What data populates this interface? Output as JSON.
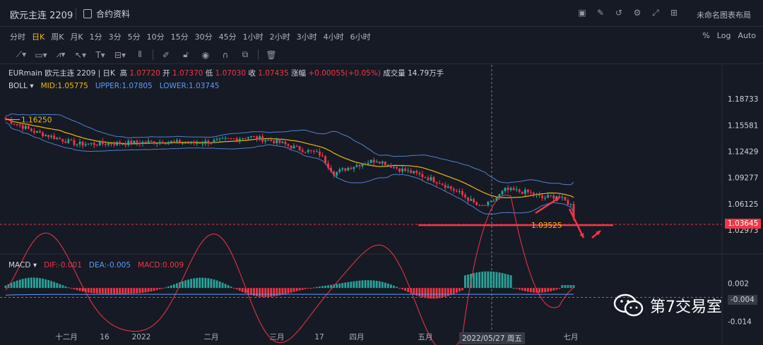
{
  "header": {
    "symbol_title": "欧元主连 2209",
    "contract_info": "合约资料",
    "layout_name": "未命名图表布局",
    "toolbar_icons": [
      "screenshot-icon",
      "edit-icon",
      "undo-icon",
      "settings-icon",
      "fullscreen-icon",
      "grid-layout-icon"
    ]
  },
  "intervals": {
    "items": [
      "分时",
      "日K",
      "周K",
      "月K",
      "1分",
      "3分",
      "5分",
      "10分",
      "15分",
      "30分",
      "45分",
      "1小时",
      "2小时",
      "3小时",
      "4小时",
      "6小时"
    ],
    "active": "日K",
    "options": [
      "%",
      "Log",
      "Auto"
    ]
  },
  "drawing_tools": [
    "trend-line-icon",
    "rectangle-icon",
    "pattern-icon",
    "cursor-icon",
    "text-tool-icon",
    "measure-icon",
    "bar-pattern-icon",
    "pencil-icon",
    "lock-icon",
    "eye-icon",
    "magnet-icon",
    "group-icon",
    "trash-icon"
  ],
  "ohlc": {
    "symbol": "EURmain",
    "name": "欧元主连 2209",
    "period": "日K",
    "high_label": "高",
    "high": "1.07720",
    "open_label": "开",
    "open": "1.07370",
    "low_label": "低",
    "low": "1.07030",
    "close_label": "收",
    "close": "1.07435",
    "change_label": "涨幅",
    "change": "+0.00055(+0.05%)",
    "volume_label": "成交量",
    "volume": "14.79万手"
  },
  "boll": {
    "name": "BOLL",
    "mid": "MID:1.05775",
    "upper": "UPPER:1.07805",
    "lower": "LOWER:1.03745"
  },
  "macd": {
    "name": "MACD",
    "dif": "DIF:-0.001",
    "dea": "DEA:-0.005",
    "macd": "MACD:0.009"
  },
  "price_axis": [
    "1.18733",
    "1.15581",
    "1.12429",
    "1.09277",
    "1.06125",
    "1.02973"
  ],
  "current_price_tag": "1.03645",
  "macd_axis": [
    "0.002",
    "-0.004",
    "-0.014"
  ],
  "macd_tag": "-0.004",
  "time_axis": [
    "十二月",
    "16",
    "2022",
    "二月",
    "三月",
    "17",
    "四月",
    "五月",
    "七月"
  ],
  "crosshair_date": "2022/05/27 周五",
  "annotations": {
    "high_marker": "1.16250",
    "low_marker": "1.03525"
  },
  "watermark": "第7交易室",
  "colors": {
    "up": "#26a69a",
    "down": "#f23645",
    "mid_line": "#f0b90b",
    "band": "#5b9cf6",
    "background": "#161a25",
    "active_interval": "#f0b90b"
  }
}
